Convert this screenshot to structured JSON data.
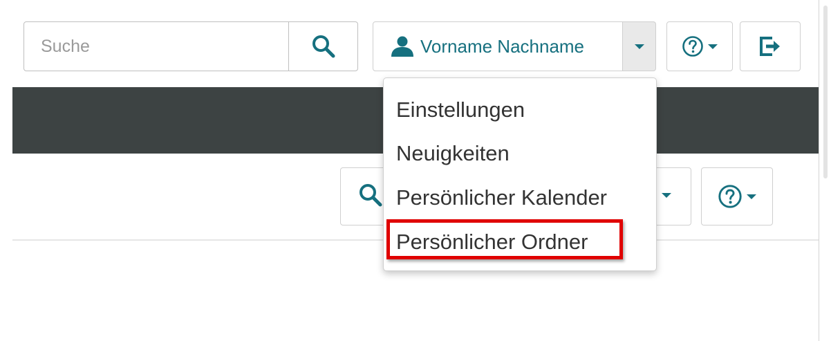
{
  "header": {
    "search": {
      "placeholder": "Suche",
      "value": ""
    },
    "user": {
      "name": "Vorname Nachname"
    }
  },
  "user_menu": {
    "items": [
      {
        "label": "Einstellungen"
      },
      {
        "label": "Neuigkeiten"
      },
      {
        "label": "Persönlicher Kalender"
      },
      {
        "label": "Persönlicher Ordner",
        "highlighted": true
      }
    ]
  },
  "icons": {
    "search": "search-icon",
    "user": "user-icon",
    "caret": "caret-down-icon",
    "help": "help-circle-icon",
    "logout": "logout-icon"
  },
  "colors": {
    "accent": "#16707f",
    "navbar": "#3d4343",
    "highlight": "#e00000"
  }
}
